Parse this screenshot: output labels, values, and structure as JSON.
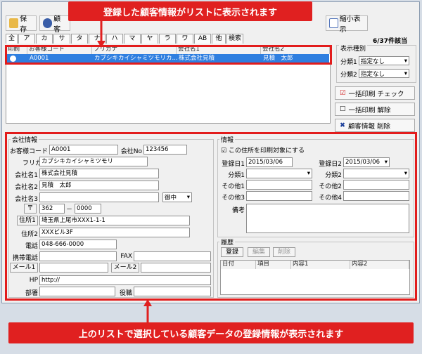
{
  "toolbar": {
    "save": "保存",
    "customer": "顧客",
    "shrink": "縮小表示"
  },
  "tabs": [
    "全",
    "ア",
    "カ",
    "サ",
    "タ",
    "ナ",
    "ハ",
    "マ",
    "ヤ",
    "ラ",
    "ワ",
    "AB",
    "他",
    "検索"
  ],
  "count": "6/37件該当",
  "columns": [
    "印刷",
    "お客様コード",
    "フリガナ",
    "会社名1",
    "会社名2"
  ],
  "row": {
    "code": "A0001",
    "kana": "カブシキカイシャミツモリカ...",
    "company1": "株式会社見積",
    "company2": "見積　太郎"
  },
  "side": {
    "title": "表示種別",
    "cat1_label": "分類1",
    "cat1_value": "指定なし",
    "cat2_label": "分類2",
    "cat2_value": "指定なし",
    "print_check": "一括印刷 チェック",
    "print_clear": "一括印刷 解除",
    "delete": "顧客情報 削除"
  },
  "company": {
    "title": "会社情報",
    "code_label": "お客様コード",
    "code": "A0001",
    "no_label": "会社No",
    "no": "123456",
    "kana_label": "フリガナ",
    "kana": "カブシキカイシャミツモリ",
    "name1_label": "会社名1",
    "name1": "株式会社見積",
    "name2_label": "会社名2",
    "name2": "見積　太郎",
    "name3_label": "会社名3",
    "honorific": "御中",
    "zip_btn": "〒",
    "zip1": "362",
    "zip_dash": "－",
    "zip2": "0000",
    "addr1_btn": "住所1",
    "addr1": "埼玉県上尾市XXX1-1-1",
    "addr2_label": "住所2",
    "addr2": "XXXビル3F",
    "tel_label": "電話",
    "tel": "048-666-0000",
    "mobile_label": "携帯電話",
    "fax_label": "FAX",
    "mail1_btn": "メール1",
    "mail2_btn": "メール2",
    "hp_label": "HP",
    "hp": "http://",
    "dept_label": "部署",
    "title_label": "役職"
  },
  "info": {
    "title": "情報",
    "print_target": "この住所を印刷対象にする",
    "reg1_label": "登録日1",
    "reg1": "2015/03/06",
    "reg2_label": "登録日2",
    "reg2": "2015/03/06",
    "cat1_label": "分類1",
    "cat2_label": "分類2",
    "other1_label": "その他1",
    "other2_label": "その他2",
    "other3_label": "その他3",
    "other4_label": "その他4",
    "note_label": "備考"
  },
  "history": {
    "title": "履歴",
    "register": "登録",
    "edit": "編集",
    "delete": "削除",
    "cols": [
      "日付",
      "項目",
      "内容1",
      "内容2"
    ]
  },
  "callouts": {
    "top": "登録した顧客情報がリストに表示されます",
    "bottom": "上のリストで選択している顧客データの登録情報が表示されます"
  }
}
